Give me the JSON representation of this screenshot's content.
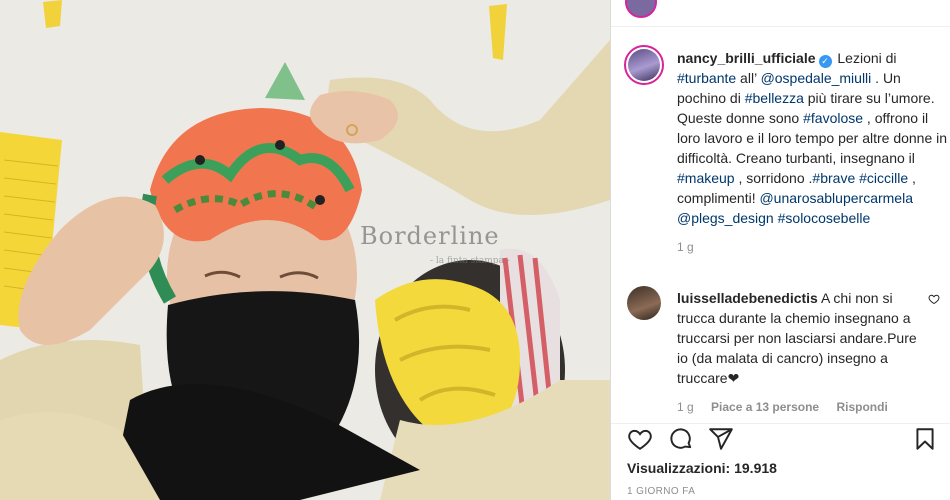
{
  "media": {
    "watermark": "Borderline",
    "watermark_sub": "- la finta stampa -"
  },
  "post": {
    "author": "nancy_brilli_ufficiale",
    "caption": [
      {
        "t": "text",
        "v": " Lezioni di "
      },
      {
        "t": "link",
        "v": "#turbante"
      },
      {
        "t": "text",
        "v": " all’ "
      },
      {
        "t": "link",
        "v": "@ospedale_miulli"
      },
      {
        "t": "text",
        "v": " . Un pochino di "
      },
      {
        "t": "link",
        "v": "#bellezza"
      },
      {
        "t": "text",
        "v": " più tirare su l’umore. Queste donne sono "
      },
      {
        "t": "link",
        "v": "#favolose"
      },
      {
        "t": "text",
        "v": " , offrono il loro lavoro e il loro tempo per altre donne in difficoltà. Creano turbanti, insegnano il "
      },
      {
        "t": "link",
        "v": "#makeup"
      },
      {
        "t": "text",
        "v": " , sorridono ."
      },
      {
        "t": "link",
        "v": "#brave"
      },
      {
        "t": "text",
        "v": " "
      },
      {
        "t": "link",
        "v": "#ciccille"
      },
      {
        "t": "text",
        "v": " , complimenti! "
      },
      {
        "t": "link",
        "v": "@unarosablupercarmela"
      },
      {
        "t": "text",
        "v": " "
      },
      {
        "t": "link",
        "v": "@plegs_design"
      },
      {
        "t": "text",
        "v": " "
      },
      {
        "t": "link",
        "v": "#solocosebelle"
      }
    ],
    "caption_age": "1 g"
  },
  "comment": {
    "author": "luisselladebenedictis",
    "text": " A chi non si trucca durante la chemio insegnano a truccarsi per non lasciarsi andare.Pure io (da malata di cancro) insegno a truccare❤",
    "age": "1 g",
    "likes": "Piace a 13 persone",
    "reply": "Rispondi"
  },
  "footer": {
    "views_label": "Visualizzazioni: ",
    "views_value": "19.918",
    "date": "1 GIORNO FA"
  },
  "icons": {
    "like": "heart-icon",
    "comment": "comment-icon",
    "share": "paper-plane-icon",
    "save": "bookmark-icon"
  },
  "colors": {
    "link": "#00376b",
    "verified": "#3897f0",
    "muted": "#8e8e8e"
  }
}
